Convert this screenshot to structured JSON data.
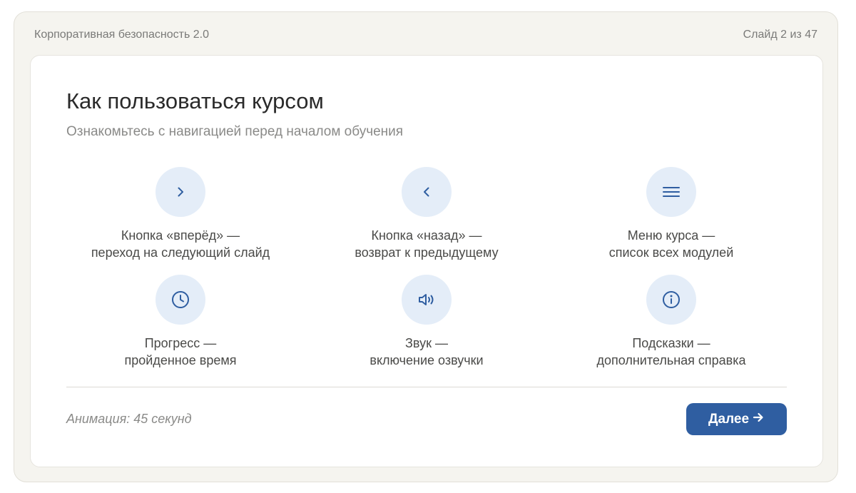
{
  "header": {
    "course_name": "Корпоративная безопасность 2.0",
    "slide_counter": "Слайд 2 из 47"
  },
  "slide": {
    "title": "Как пользоваться курсом",
    "subtitle": "Ознакомьтесь с навигацией перед началом обучения"
  },
  "features": [
    {
      "icon": "chevron-right-icon",
      "title": "Кнопка «вперёд» —",
      "desc": "переход на следующий слайд"
    },
    {
      "icon": "chevron-left-icon",
      "title": "Кнопка «назад» —",
      "desc": "возврат к предыдущему"
    },
    {
      "icon": "menu-icon",
      "title": "Меню курса —",
      "desc": "список всех модулей"
    },
    {
      "icon": "clock-icon",
      "title": "Прогресс —",
      "desc": "пройденное время"
    },
    {
      "icon": "speaker-icon",
      "title": "Звук —",
      "desc": "включение озвучки"
    },
    {
      "icon": "info-icon",
      "title": "Подсказки —",
      "desc": "дополнительная справка"
    }
  ],
  "footer": {
    "animation_note": "Анимация: 45 секунд",
    "next_label": "Далее",
    "next_icon": "arrow-right-icon"
  },
  "colors": {
    "accent": "#2f5ea1",
    "icon_bg": "#e4edf8",
    "shell_bg": "#f5f4ef"
  }
}
